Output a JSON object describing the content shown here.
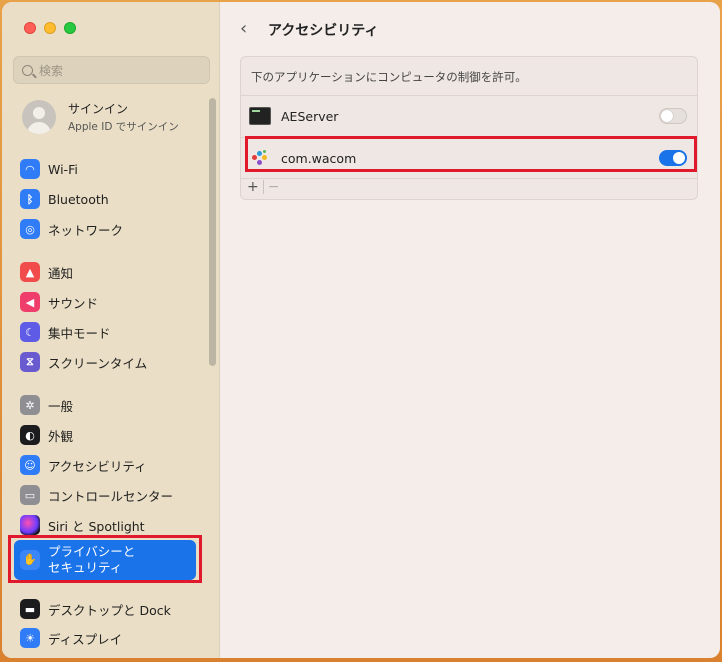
{
  "window": {
    "title": "アクセシビリティ"
  },
  "search": {
    "placeholder": "検索"
  },
  "account": {
    "name": "サインイン",
    "subtitle": "Apple ID でサインイン"
  },
  "sidebar": {
    "items": [
      {
        "label": "Wi-Fi",
        "icon": "wifi-icon",
        "color": "#2f7cf6"
      },
      {
        "label": "Bluetooth",
        "icon": "bluetooth-icon",
        "color": "#2f7cf6"
      },
      {
        "label": "ネットワーク",
        "icon": "globe-icon",
        "color": "#2f7cf6"
      },
      {
        "label": "通知",
        "icon": "bell-icon",
        "color": "#f24b4b"
      },
      {
        "label": "サウンド",
        "icon": "speaker-icon",
        "color": "#ef3e6c"
      },
      {
        "label": "集中モード",
        "icon": "moon-icon",
        "color": "#5e5ce6"
      },
      {
        "label": "スクリーンタイム",
        "icon": "hourglass-icon",
        "color": "#6a5ad0"
      },
      {
        "label": "一般",
        "icon": "gear-icon",
        "color": "#8e8e93"
      },
      {
        "label": "外観",
        "icon": "appearance-icon",
        "color": "#1c1c1e"
      },
      {
        "label": "アクセシビリティ",
        "icon": "accessibility-icon",
        "color": "#2f7cf6"
      },
      {
        "label": "コントロールセンター",
        "icon": "control-center-icon",
        "color": "#8e8e93"
      },
      {
        "label": "Siri と Spotlight",
        "icon": "siri-icon",
        "color": "#6b3cff"
      },
      {
        "label": "プライバシーと\nセキュリティ",
        "icon": "hand-icon",
        "color": "#2f7cf6",
        "selected": true
      },
      {
        "label": "デスクトップと Dock",
        "icon": "dock-icon",
        "color": "#1c1c1e"
      },
      {
        "label": "ディスプレイ",
        "icon": "sun-icon",
        "color": "#2f7cf6"
      }
    ]
  },
  "privacy_label_line1": "プライバシーと",
  "privacy_label_line2": "セキュリティ",
  "main": {
    "back": "‹",
    "description": "下のアプリケーションにコンピュータの制御を許可。",
    "apps": [
      {
        "name": "AEServer",
        "enabled": false,
        "icon": "terminal-app-icon"
      },
      {
        "name": "com.wacom",
        "enabled": true,
        "icon": "wacom-app-icon"
      }
    ],
    "add_label": "+",
    "remove_label": "−"
  },
  "colors": {
    "accent": "#1a73e8",
    "highlight": "#e0192c"
  }
}
